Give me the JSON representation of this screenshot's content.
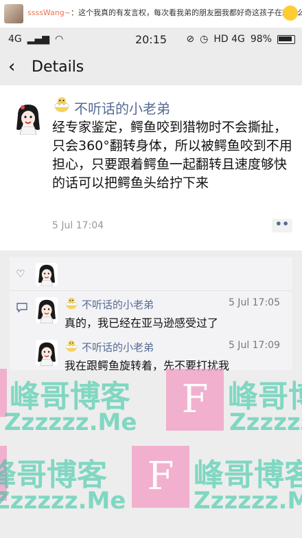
{
  "weibo_header": {
    "username": "ssssWang~",
    "message": "：这个我真的有发言权，每次看我弟的朋友圈我都好奇这孩子在想什么呢"
  },
  "status_bar": {
    "network_left": "4G",
    "time": "20:15",
    "network_right": "HD 4G",
    "battery": "98%"
  },
  "nav": {
    "title": "Details"
  },
  "post": {
    "author": "不听话的小老弟",
    "body": "经专家鉴定，鳄鱼咬到猎物时不会撕扯，只会360°翻转身体，所以被鳄鱼咬到不用担心，只要跟着鳄鱼一起翻转且速度够快的话可以把鳄鱼头给拧下来",
    "time": "5 Jul 17:04",
    "more": "••"
  },
  "comments": [
    {
      "author": "不听话的小老弟",
      "time": "5 Jul 17:05",
      "text": "真的，我已经在亚马逊感受过了"
    },
    {
      "author": "不听话的小老弟",
      "time": "5 Jul 17:09",
      "text": "我在跟鳄鱼旋转着，先不要打扰我"
    }
  ],
  "watermark": {
    "blog_name": "峰哥博客",
    "url": "Zzzzzz.Me",
    "logo_letter": "F"
  },
  "colors": {
    "link_blue": "#576b95",
    "watermark_green": "#26c49e",
    "watermark_pink": "#f295c1"
  }
}
